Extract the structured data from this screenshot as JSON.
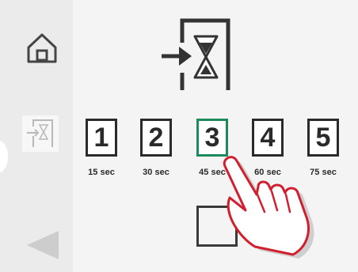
{
  "sidebar": {
    "home_icon": "home-icon",
    "door_icon": "door-timer-icon",
    "back_icon": "back-arrow-icon"
  },
  "main": {
    "header_icon": "door-timer-icon",
    "options": [
      {
        "number": "1",
        "duration": "15 sec",
        "selected": false
      },
      {
        "number": "2",
        "duration": "30 sec",
        "selected": false
      },
      {
        "number": "3",
        "duration": "45 sec",
        "selected": true
      },
      {
        "number": "4",
        "duration": "60 sec",
        "selected": false
      },
      {
        "number": "5",
        "duration": "75 sec",
        "selected": false
      }
    ]
  },
  "colors": {
    "background": "#f4f4f4",
    "sidebar": "#ebebeb",
    "tile_border": "#2a2a2a",
    "selected_border": "#1e8a5b",
    "hand_outline": "#d11f2f"
  }
}
